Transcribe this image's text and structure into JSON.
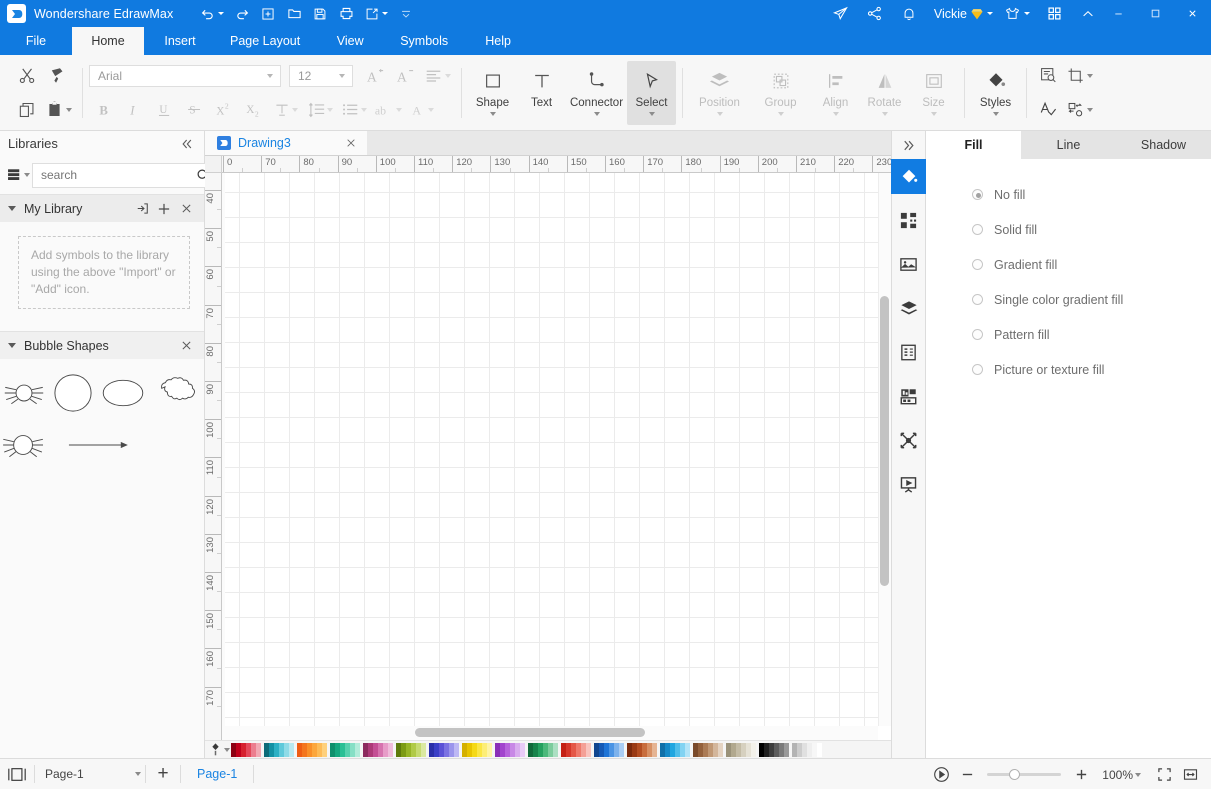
{
  "titlebar": {
    "app_title": "Wondershare EdrawMax",
    "logo_icon": "edrawmax-logo-icon",
    "quick_access": [
      {
        "name": "undo-button",
        "icon": "undo-icon",
        "has_dropdown": true
      },
      {
        "name": "redo-button",
        "icon": "redo-icon",
        "has_dropdown": false
      },
      {
        "name": "new-button",
        "icon": "new-document-icon",
        "has_dropdown": false
      },
      {
        "name": "open-button",
        "icon": "folder-open-icon",
        "has_dropdown": false
      },
      {
        "name": "save-button",
        "icon": "save-floppy-icon",
        "has_dropdown": false
      },
      {
        "name": "print-button",
        "icon": "printer-icon",
        "has_dropdown": false
      },
      {
        "name": "export-button",
        "icon": "export-share-icon",
        "has_dropdown": true
      },
      {
        "name": "customize-qat-button",
        "icon": "chevron-down-thin-icon",
        "has_dropdown": false
      }
    ],
    "right_icons": [
      {
        "name": "send-feedback-button",
        "icon": "paper-plane-icon"
      },
      {
        "name": "share-button",
        "icon": "share-nodes-icon"
      },
      {
        "name": "notifications-button",
        "icon": "bell-icon"
      }
    ],
    "user_name": "Vickie",
    "user_badge_icon": "vip-diamond-icon",
    "theme_icon": "tshirt-theme-icon",
    "apps_icon": "grid-apps-icon",
    "collapse_icon": "chevron-up-icon",
    "window_buttons": {
      "minimize": "minimize-icon",
      "maximize": "maximize-icon",
      "close": "close-icon"
    }
  },
  "menubar": {
    "tabs": [
      {
        "label": "File",
        "active": false
      },
      {
        "label": "Home",
        "active": true
      },
      {
        "label": "Insert",
        "active": false
      },
      {
        "label": "Page Layout",
        "active": false
      },
      {
        "label": "View",
        "active": false
      },
      {
        "label": "Symbols",
        "active": false
      },
      {
        "label": "Help",
        "active": false
      }
    ]
  },
  "ribbon": {
    "clipboard": [
      {
        "name": "cut-button",
        "icon": "scissors-icon"
      },
      {
        "name": "format-painter-button",
        "icon": "format-painter-icon"
      },
      {
        "name": "copy-button",
        "icon": "copy-icon"
      },
      {
        "name": "paste-button",
        "icon": "clipboard-paste-icon",
        "has_dropdown": true
      }
    ],
    "font_family": "Arial",
    "font_size": "12",
    "font_tools_row1": [
      {
        "name": "increase-font-size-button",
        "icon": "font-increase-icon"
      },
      {
        "name": "decrease-font-size-button",
        "icon": "font-decrease-icon"
      },
      {
        "name": "paragraph-align-button",
        "icon": "align-text-icon",
        "has_dropdown": true
      }
    ],
    "font_tools_row2": [
      {
        "name": "bold-button",
        "icon": "bold-icon",
        "label": "B"
      },
      {
        "name": "italic-button",
        "icon": "italic-icon",
        "label": "I"
      },
      {
        "name": "underline-button",
        "icon": "underline-icon",
        "label": "U"
      },
      {
        "name": "strikethrough-button",
        "icon": "strikethrough-icon",
        "label": "S"
      },
      {
        "name": "superscript-button",
        "icon": "superscript-icon",
        "label": "X²"
      },
      {
        "name": "subscript-button",
        "icon": "subscript-icon",
        "label": "X₂"
      },
      {
        "name": "text-vertical-align-button",
        "icon": "text-vertical-align-icon",
        "has_dropdown": true
      },
      {
        "name": "line-spacing-button",
        "icon": "line-spacing-icon",
        "has_dropdown": true
      },
      {
        "name": "bullet-list-button",
        "icon": "bullet-list-icon",
        "has_dropdown": true
      },
      {
        "name": "text-case-button",
        "icon": "text-case-ab-icon",
        "has_dropdown": true
      },
      {
        "name": "font-color-button",
        "icon": "font-color-a-icon",
        "has_dropdown": true
      }
    ],
    "tools": [
      {
        "name": "shape-tool",
        "label": "Shape",
        "icon": "square-shape-icon",
        "dropdown": true,
        "disabled": false,
        "active": false
      },
      {
        "name": "text-tool",
        "label": "Text",
        "icon": "text-t-icon",
        "dropdown": false,
        "disabled": false,
        "active": false
      },
      {
        "name": "connector-tool",
        "label": "Connector",
        "icon": "connector-elbow-icon",
        "dropdown": true,
        "disabled": false,
        "active": false
      },
      {
        "name": "select-tool",
        "label": "Select",
        "icon": "cursor-arrow-icon",
        "dropdown": true,
        "disabled": false,
        "active": true
      }
    ],
    "arrange": [
      {
        "name": "position-tool",
        "label": "Position",
        "icon": "layers-position-icon",
        "dropdown": true,
        "disabled": true
      },
      {
        "name": "group-tool",
        "label": "Group",
        "icon": "group-objects-icon",
        "dropdown": true,
        "disabled": true
      },
      {
        "name": "align-tool",
        "label": "Align",
        "icon": "align-left-objects-icon",
        "dropdown": true,
        "disabled": true
      },
      {
        "name": "rotate-tool",
        "label": "Rotate",
        "icon": "rotate-flip-icon",
        "dropdown": true,
        "disabled": true
      },
      {
        "name": "size-tool",
        "label": "Size",
        "icon": "resize-box-icon",
        "dropdown": true,
        "disabled": true
      }
    ],
    "styles": {
      "name": "styles-tool",
      "label": "Styles",
      "icon": "paint-bucket-icon",
      "dropdown": true
    },
    "extra": [
      {
        "name": "find-replace-button",
        "icon": "find-document-icon",
        "has_dropdown": false
      },
      {
        "name": "crop-button",
        "icon": "crop-icon",
        "has_dropdown": true
      },
      {
        "name": "spell-check-button",
        "icon": "spell-check-icon",
        "has_dropdown": false
      },
      {
        "name": "replace-shape-button",
        "icon": "replace-shape-icon",
        "has_dropdown": true
      }
    ]
  },
  "libraries": {
    "title": "Libraries",
    "collapse_icon": "double-chevron-left-icon",
    "library_picker_icon": "library-drawer-icon",
    "search": {
      "value": "",
      "placeholder": "search",
      "icon": "search-icon"
    },
    "nav_up_icon": "chevron-up-icon",
    "nav_down_icon": "chevron-down-icon",
    "sections": [
      {
        "title": "My Library",
        "expanded": true,
        "icons": [
          {
            "name": "import-symbols-button",
            "icon": "import-icon"
          },
          {
            "name": "add-symbols-button",
            "icon": "plus-icon"
          },
          {
            "name": "close-library-button",
            "icon": "close-icon"
          }
        ],
        "placeholder": "Add symbols to the library using the above \"Import\" or \"Add\" icon."
      },
      {
        "title": "Bubble Shapes",
        "expanded": true,
        "icons": [
          {
            "name": "close-library-button",
            "icon": "close-icon"
          }
        ],
        "shapes": [
          {
            "name": "shape-burst-bubble-small",
            "icon": "burst-bubble-icon"
          },
          {
            "name": "shape-circle",
            "icon": "circle-icon"
          },
          {
            "name": "shape-ellipse",
            "icon": "ellipse-icon"
          },
          {
            "name": "shape-cloud",
            "icon": "cloud-icon"
          },
          {
            "name": "shape-burst-bubble-large",
            "icon": "burst-bubble-icon"
          },
          {
            "name": "shape-arrow-line",
            "icon": "arrow-line-icon"
          }
        ]
      }
    ]
  },
  "canvas": {
    "document_tab": {
      "label": "Drawing3",
      "icon": "edrawmax-document-icon",
      "close_icon": "close-icon"
    },
    "h_ruler_labels": [
      "0",
      "70",
      "80",
      "90",
      "100",
      "110",
      "120",
      "130",
      "140",
      "150",
      "160",
      "170",
      "180",
      "190",
      "200",
      "210",
      "220",
      "230"
    ],
    "v_ruler_labels": [
      "40",
      "50",
      "60",
      "70",
      "80",
      "90",
      "100",
      "110",
      "120",
      "130",
      "140",
      "150",
      "160",
      "170"
    ],
    "palette_icon": "color-dropper-icon",
    "palette_colors": [
      "#8c0012",
      "#c0001b",
      "#d6202e",
      "#e4485a",
      "#ec7d8e",
      "#f2a9b4",
      "#0d6b78",
      "#1391a4",
      "#2cb0c4",
      "#5fc9da",
      "#8fdbe7",
      "#b9e9f1",
      "#ee5d14",
      "#f4751d",
      "#f98f29",
      "#fca63c",
      "#fdbb57",
      "#fed07c",
      "#0d8f6b",
      "#14a77e",
      "#2bbf95",
      "#57d1ae",
      "#86dfc5",
      "#b2ecda",
      "#8c2a5e",
      "#ad3a78",
      "#c44f94",
      "#d673ae",
      "#e79cc8",
      "#f0bcdb",
      "#5e7a0d",
      "#7c9b14",
      "#97b527",
      "#b0ca47",
      "#c6db71",
      "#dbe9a1",
      "#2a2fa8",
      "#3a3fc6",
      "#5b52d6",
      "#7b72e2",
      "#9b95ec",
      "#bdb8f4",
      "#d4b000",
      "#e8c400",
      "#f5d916",
      "#fbe645",
      "#fdee77",
      "#fef4a6",
      "#8a2fb8",
      "#a244cd",
      "#b763dc",
      "#c888e6",
      "#d9acef",
      "#e8cbf6",
      "#11693a",
      "#17834a",
      "#25a05f",
      "#4bb87a",
      "#7ccc9d",
      "#abdfc2",
      "#c42014",
      "#d6372a",
      "#e45747",
      "#ee7a6c",
      "#f4a096",
      "#f9c4be",
      "#11468f",
      "#1559b5",
      "#1f74d6",
      "#4b94e4",
      "#7db2ec",
      "#aacdf4",
      "#7a2a0d",
      "#9a3a14",
      "#b34e22",
      "#c86d3d",
      "#d79064",
      "#e5b493",
      "#0f6fa8",
      "#1589c7",
      "#20a6e0",
      "#4fbeea",
      "#82d3f2",
      "#b2e4f8",
      "#7a4a2a",
      "#94613c",
      "#ab7b55",
      "#c09875",
      "#d3b69b",
      "#e4d3c2",
      "#9a927a",
      "#b1a88e",
      "#c4bca6",
      "#d6d0bf",
      "#e6e2d6",
      "#f3f1ea",
      "#000000",
      "#1f1f1f",
      "#3d3d3d",
      "#5c5c5c",
      "#7a7a7a",
      "#999999",
      "#b3b3b3",
      "#cccccc",
      "#e0e0e0",
      "#efefef",
      "#f7f7f7",
      "#ffffff"
    ]
  },
  "icon_rail": {
    "expand_icon": "double-chevron-right-icon",
    "buttons": [
      {
        "name": "rail-fill-style",
        "icon": "paint-bucket-icon",
        "active": true
      },
      {
        "name": "rail-quick-shapes",
        "icon": "grid-shapes-icon",
        "active": false
      },
      {
        "name": "rail-picture",
        "icon": "picture-icon",
        "active": false
      },
      {
        "name": "rail-layers",
        "icon": "layers-icon",
        "active": false
      },
      {
        "name": "rail-page-setup",
        "icon": "page-document-icon",
        "active": false
      },
      {
        "name": "rail-chart-data",
        "icon": "chart-data-icon",
        "active": false
      },
      {
        "name": "rail-connector-style",
        "icon": "connector-nodes-icon",
        "active": false
      },
      {
        "name": "rail-presentation",
        "icon": "presentation-icon",
        "active": false
      }
    ]
  },
  "properties": {
    "tabs": [
      {
        "label": "Fill",
        "active": true
      },
      {
        "label": "Line",
        "active": false
      },
      {
        "label": "Shadow",
        "active": false
      }
    ],
    "fill_options": [
      {
        "label": "No fill",
        "selected": true
      },
      {
        "label": "Solid fill",
        "selected": false
      },
      {
        "label": "Gradient fill",
        "selected": false
      },
      {
        "label": "Single color gradient fill",
        "selected": false
      },
      {
        "label": "Pattern fill",
        "selected": false
      },
      {
        "label": "Picture or texture fill",
        "selected": false
      }
    ]
  },
  "statusbar": {
    "panel_toggle_icon": "panel-layout-icon",
    "page_selector": {
      "value": "Page-1",
      "dropdown_icon": "chevron-down-icon"
    },
    "add_page_icon": "plus-icon",
    "page_tab": "Page-1",
    "presentation_icon": "play-circle-icon",
    "zoom_out_icon": "minus-icon",
    "zoom_in_icon": "plus-icon",
    "zoom_value": "100%",
    "zoom_dropdown_icon": "chevron-down-icon",
    "fit_page_icon": "fit-page-icon",
    "fit_width_icon": "fit-width-icon"
  }
}
